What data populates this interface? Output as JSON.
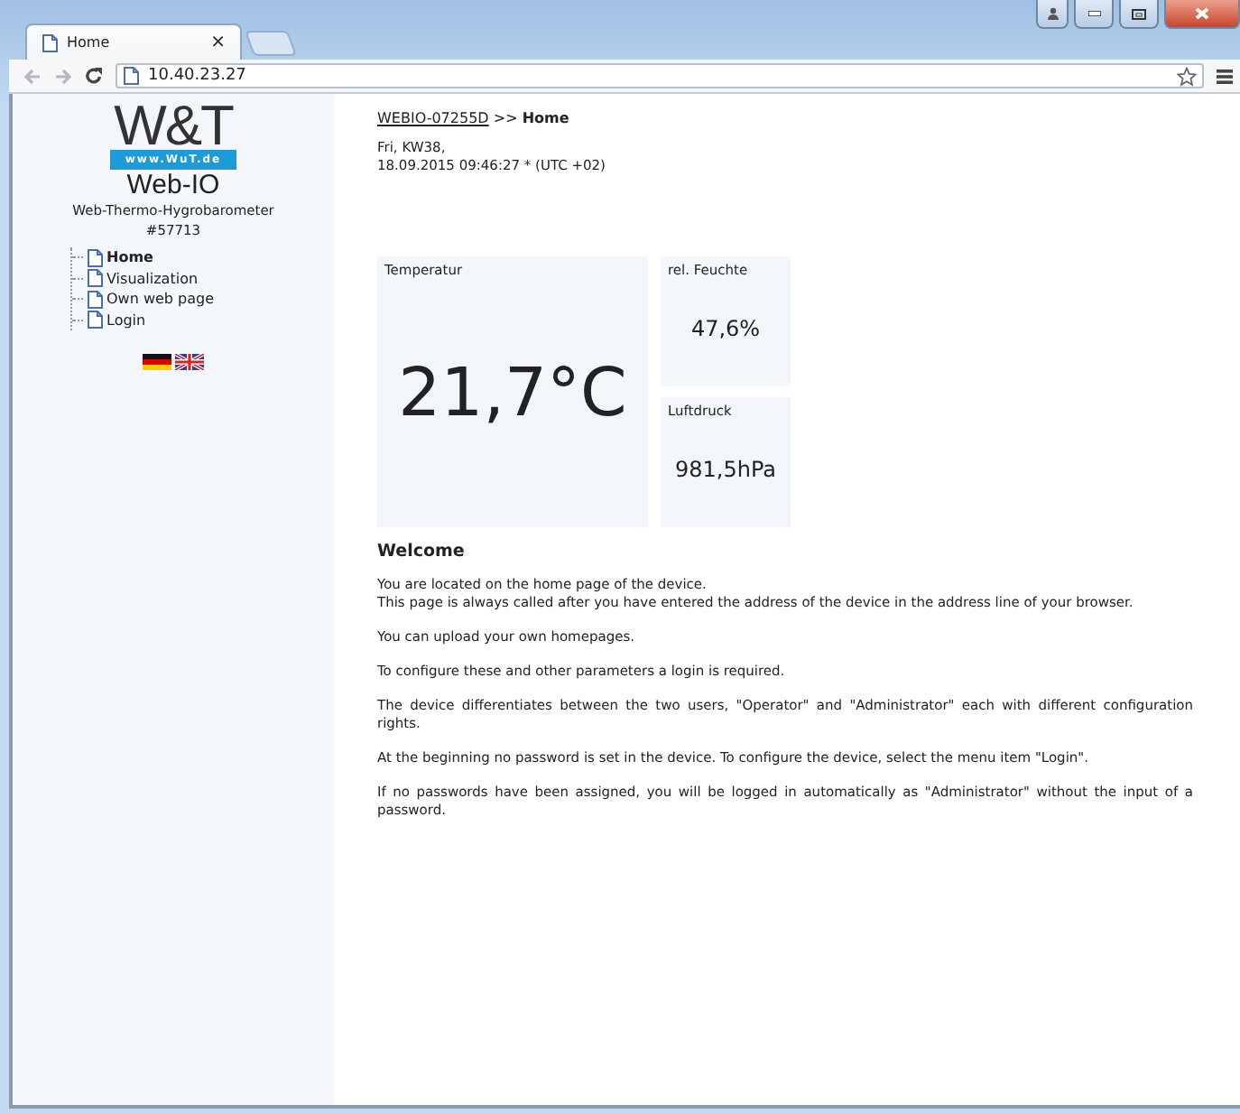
{
  "browser": {
    "tab": {
      "title": "Home",
      "close": "×"
    },
    "address": "10.40.23.27"
  },
  "sidebar": {
    "logo": {
      "brand": "W&T",
      "url": "www.WuT.de",
      "product": "Web-IO"
    },
    "device": "Web-Thermo-Hygrobarometer",
    "article": "#57713",
    "menu": [
      {
        "label": "Home",
        "selected": true
      },
      {
        "label": "Visualization",
        "selected": false
      },
      {
        "label": "Own web page",
        "selected": false
      },
      {
        "label": "Login",
        "selected": false
      }
    ]
  },
  "main": {
    "breadcrumb": {
      "device": "WEBIO-07255D",
      "separator": ">>",
      "page": "Home"
    },
    "date": [
      "Fri, KW38,",
      "18.09.2015 09:46:27 * (UTC +02)"
    ],
    "tiles": [
      {
        "kind": "large",
        "label": "Temperatur",
        "value": "21,7°C"
      },
      {
        "kind": "small",
        "label": "rel. Feuchte",
        "value": "47,6%"
      },
      {
        "kind": "small",
        "label": "Luftdruck",
        "value": "981,5hPa"
      }
    ],
    "heading": "Welcome",
    "paragraphs": [
      [
        "You are located on the home page of the device.",
        "This page is always called after you have entered the address of the device in the address line of your browser."
      ],
      [
        "You can upload your own homepages."
      ],
      [
        "To configure these and other parameters a login is required."
      ],
      [
        "The device differentiates between the two users, \"Operator\" and \"Administrator\" each with different configuration rights."
      ],
      [
        "At the beginning no password is set in the device. To configure the device, select the menu item \"Login\"."
      ],
      [
        "If no passwords have been assigned, you will be logged in automatically as \"Administrator\" without the input of a password."
      ]
    ]
  }
}
